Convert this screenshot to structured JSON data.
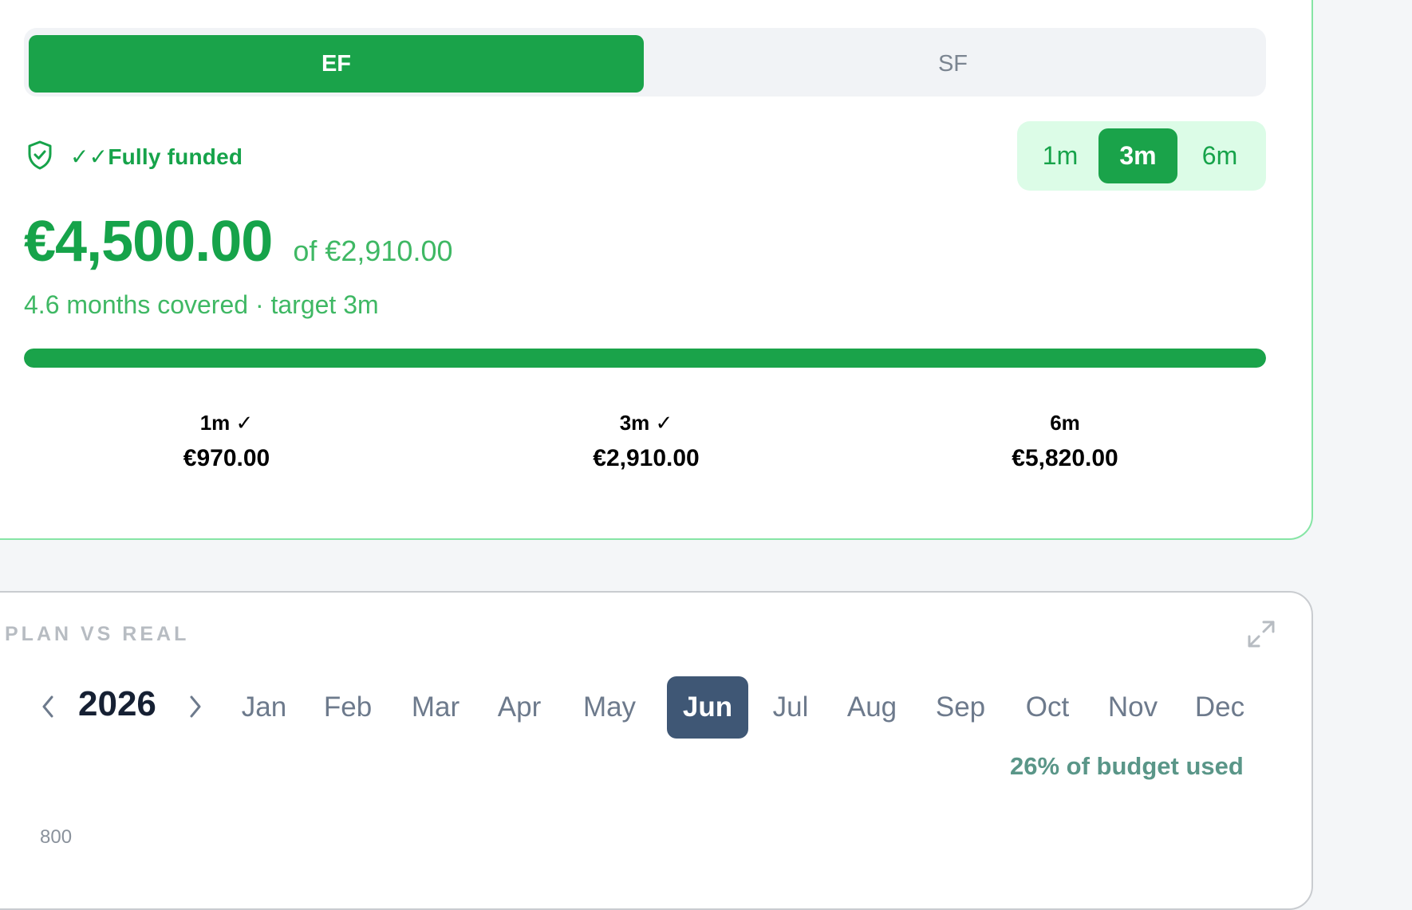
{
  "fund_selector": {
    "options": [
      "EF",
      "SF"
    ],
    "selected": "EF"
  },
  "status": {
    "label": "✓✓Fully funded",
    "icon": "shield-check-icon"
  },
  "period_selector": {
    "options": [
      "1m",
      "3m",
      "6m"
    ],
    "selected": "3m"
  },
  "balance": {
    "amount": "€4,500.00",
    "of_target": "of €2,910.00"
  },
  "coverage": {
    "text": "4.6 months covered · target 3m"
  },
  "progress": {
    "fraction": 1.0
  },
  "milestones": [
    {
      "label": "1m ✓",
      "value": "€970.00",
      "reached": true
    },
    {
      "label": "3m ✓",
      "value": "€2,910.00",
      "reached": true
    },
    {
      "label": "6m",
      "value": "€5,820.00",
      "reached": false
    }
  ],
  "plan_vs_real": {
    "title": "PLAN VS REAL",
    "year": "2026",
    "months": [
      "Jan",
      "Feb",
      "Mar",
      "Apr",
      "May",
      "Jun",
      "Jul",
      "Aug",
      "Sep",
      "Oct",
      "Nov",
      "Dec"
    ],
    "selected_month": "Jun",
    "budget_used": "26% of budget used",
    "y_tick_top": "800"
  },
  "colors": {
    "accent_green": "#1aa34a",
    "light_green": "#dcfce7",
    "active_month": "#3f5775",
    "budget_text": "#5a9688"
  }
}
